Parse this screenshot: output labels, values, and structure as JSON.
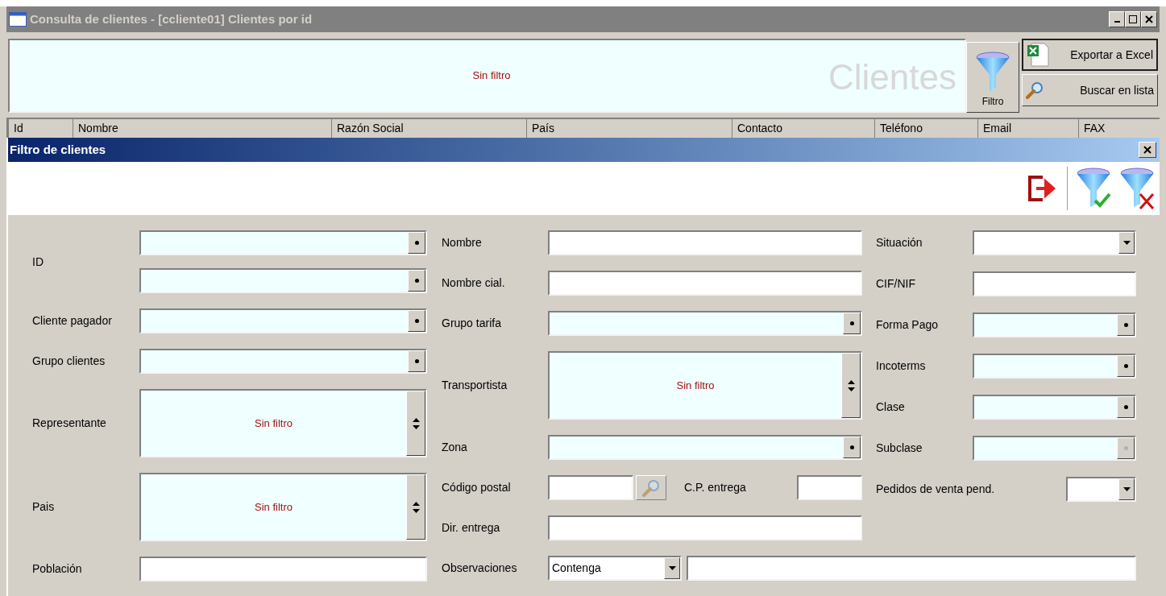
{
  "window": {
    "title": "Consulta de clientes - [ccliente01] Clientes por id",
    "active": false
  },
  "header": {
    "filter_status": "Sin filtro",
    "heading": "Clientes",
    "filter_button": "Filtro",
    "buttons": [
      {
        "label": "Exportar a Excel",
        "kind": "excel"
      },
      {
        "label": "Buscar en lista",
        "kind": "search"
      }
    ]
  },
  "table": {
    "columns": [
      "Id",
      "Nombre",
      "Razón Social",
      "País",
      "Contacto",
      "Teléfono",
      "Email",
      "FAX"
    ]
  },
  "dialog": {
    "title": "Filtro de clientes",
    "left_column": [
      {
        "label": "ID",
        "kind": "range"
      },
      {
        "label": "Cliente pagador",
        "kind": "combo"
      },
      {
        "label": "Grupo clientes",
        "kind": "combo"
      },
      {
        "label": "Representante",
        "kind": "list",
        "value": "Sin filtro"
      },
      {
        "label": "Pais",
        "kind": "list",
        "value": "Sin filtro"
      },
      {
        "label": "Población",
        "kind": "text"
      }
    ],
    "middle_column": [
      {
        "label": "Nombre",
        "kind": "text"
      },
      {
        "label": "Nombre cial.",
        "kind": "text"
      },
      {
        "label": "Grupo tarifa",
        "kind": "combo"
      },
      {
        "label": "Transportista",
        "kind": "list",
        "value": "Sin filtro"
      },
      {
        "label": "Zona",
        "kind": "combo"
      },
      {
        "label": "Código postal",
        "kind": "lookup",
        "extra": {
          "label": "C.P. entrega"
        }
      },
      {
        "label": "Dir. entrega",
        "kind": "text"
      }
    ],
    "right_column": [
      {
        "label": "Situación",
        "kind": "dropdown"
      },
      {
        "label": "CIF/NIF",
        "kind": "text"
      },
      {
        "label": "Forma Pago",
        "kind": "combo"
      },
      {
        "label": "Incoterms",
        "kind": "combo"
      },
      {
        "label": "Clase",
        "kind": "combo"
      },
      {
        "label": "Subclase",
        "kind": "combo",
        "disabled": true
      },
      {
        "label": "Pedidos de venta pend.",
        "kind": "smalldropdown"
      }
    ],
    "observaciones": {
      "label": "Observaciones",
      "mode": "Contenga"
    }
  }
}
